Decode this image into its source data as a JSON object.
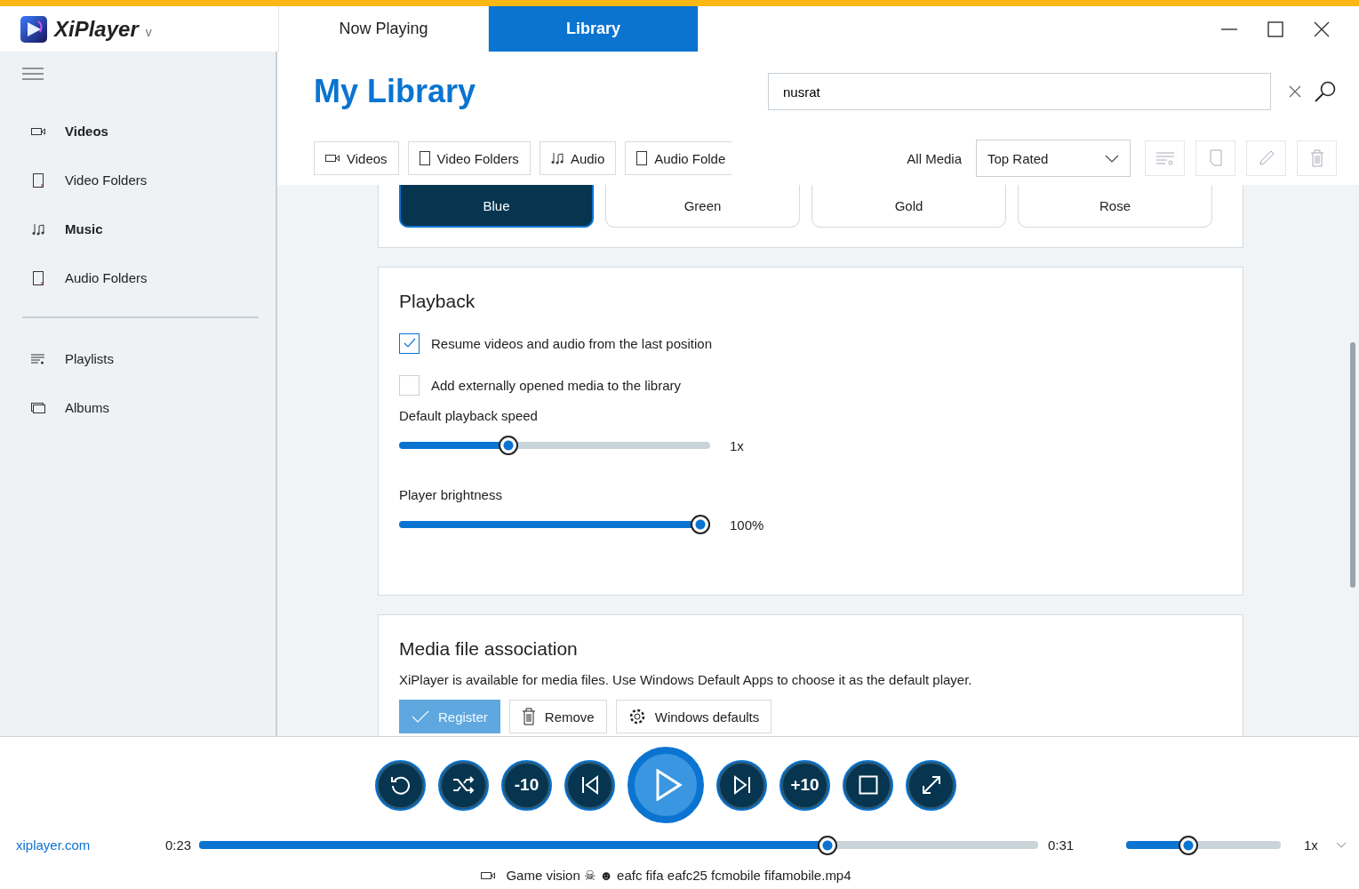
{
  "app": {
    "name": "XiPlayer",
    "menu_caret": "v"
  },
  "tabs": [
    {
      "label": "Now Playing",
      "selected": false
    },
    {
      "label": "Library",
      "selected": true
    }
  ],
  "sidebar": {
    "groups": [
      [
        {
          "kind": "video",
          "label": "Videos",
          "selected": true
        },
        {
          "kind": "folder",
          "label": "Video Folders",
          "selected": false
        },
        {
          "kind": "music",
          "label": "Music",
          "selected": true
        },
        {
          "kind": "folder",
          "label": "Audio Folders",
          "selected": false
        }
      ],
      [
        {
          "kind": "playlist",
          "label": "Playlists",
          "selected": false
        },
        {
          "kind": "album",
          "label": "Albums",
          "selected": false
        }
      ]
    ]
  },
  "library": {
    "title": "My Library",
    "search": {
      "value": "nusrat"
    },
    "filters": [
      {
        "kind": "video",
        "label": "Videos"
      },
      {
        "kind": "folder",
        "label": "Video Folders"
      },
      {
        "kind": "music",
        "label": "Audio"
      },
      {
        "kind": "folder",
        "label": "Audio Folde"
      }
    ],
    "scope_label": "All Media",
    "sort": {
      "value": "Top Rated"
    },
    "tools": [
      {
        "kind": "playlist"
      },
      {
        "kind": "folder"
      },
      {
        "kind": "edit"
      },
      {
        "kind": "delete"
      }
    ]
  },
  "theme_colors": [
    {
      "label": "Blue",
      "selected": true
    },
    {
      "label": "Green",
      "selected": false
    },
    {
      "label": "Gold",
      "selected": false
    },
    {
      "label": "Rose",
      "selected": false
    }
  ],
  "playback": {
    "title": "Playback",
    "options": [
      {
        "label": "Resume videos and audio from the last position",
        "checked": true
      },
      {
        "label": "Add externally opened media to the library",
        "checked": false
      }
    ],
    "sliders": [
      {
        "label": "Default playback speed",
        "level": 0.34,
        "reading": "1x"
      },
      {
        "label": "Player brightness",
        "level": 1.0,
        "reading": "100%"
      }
    ]
  },
  "association": {
    "title": "Media file association",
    "text": "XiPlayer is available for media files. Use Windows Default Apps to choose it as the default player.",
    "buttons": [
      {
        "kind": "check",
        "label": "Register",
        "disabled": true
      },
      {
        "kind": "delete",
        "label": "Remove",
        "disabled": false
      },
      {
        "kind": "gear",
        "label": "Windows defaults",
        "disabled": false
      }
    ]
  },
  "player": {
    "controls": [
      {
        "kind": "repeat"
      },
      {
        "kind": "shuffle"
      },
      {
        "kind": "text",
        "label": "-10"
      },
      {
        "kind": "prev"
      },
      {
        "kind": "play"
      },
      {
        "kind": "next"
      },
      {
        "kind": "text",
        "label": "+10"
      },
      {
        "kind": "stop"
      },
      {
        "kind": "fullscreen"
      }
    ],
    "site": "xiplayer.com",
    "elapsed": "0:23",
    "progress": {
      "level": 0.755
    },
    "duration": "0:31",
    "volume": {
      "level": 0.39
    },
    "speed": "1x",
    "now_playing": "Game vision ☠ ☻ eafc fifa eafc25 fcmobile fifamobile.mp4"
  }
}
